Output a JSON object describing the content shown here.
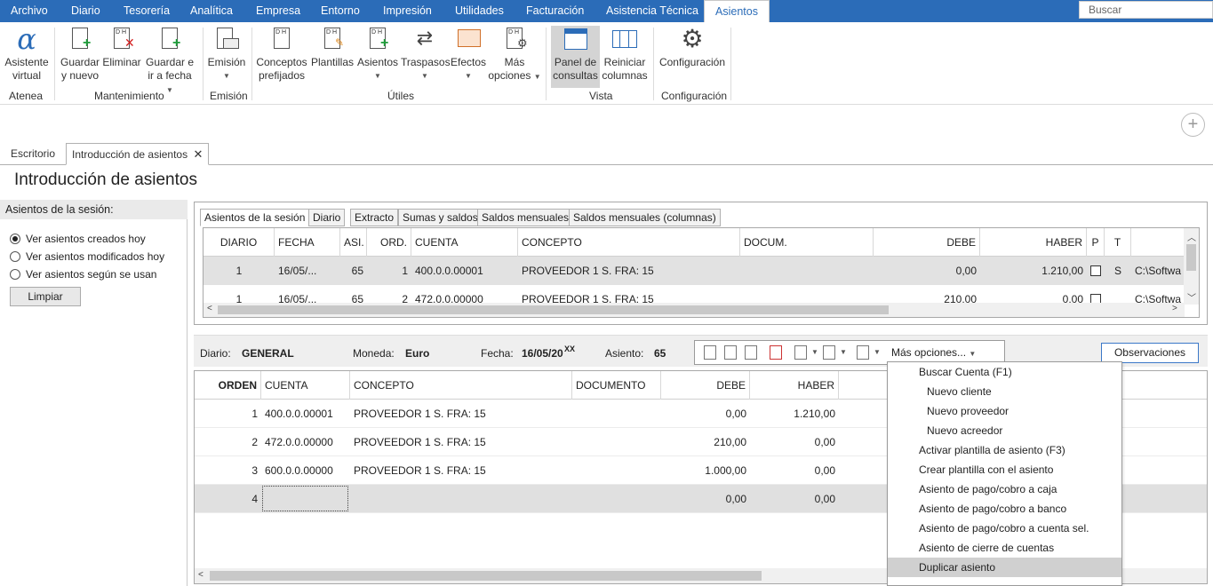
{
  "menubar": {
    "tabs": [
      "Archivo",
      "Diario",
      "Tesorería",
      "Analítica",
      "Empresa",
      "Entorno",
      "Impresión",
      "Utilidades",
      "Facturación",
      "Asistencia Técnica",
      "Asientos"
    ],
    "active_tab": "Asientos",
    "search_placeholder": "Buscar"
  },
  "ribbon": {
    "groups": {
      "atenea": "Atenea",
      "mantenimiento": "Mantenimiento",
      "emision": "Emisión",
      "utiles": "Útiles",
      "vista": "Vista",
      "configuracion": "Configuración"
    },
    "buttons": {
      "asistente": [
        "Asistente",
        "virtual"
      ],
      "guardar_nuevo": [
        "Guardar",
        "y nuevo"
      ],
      "eliminar": [
        "Eliminar"
      ],
      "guardar_fecha": [
        "Guardar e",
        "ir a fecha"
      ],
      "emision": [
        "Emisión"
      ],
      "conceptos": [
        "Conceptos",
        "prefijados"
      ],
      "plantillas": [
        "Plantillas"
      ],
      "asientos": [
        "Asientos"
      ],
      "traspasos": [
        "Traspasos"
      ],
      "efectos": [
        "Efectos"
      ],
      "mas_opciones": [
        "Más",
        "opciones"
      ],
      "panel": [
        "Panel de",
        "consultas"
      ],
      "reiniciar": [
        "Reiniciar",
        "columnas"
      ],
      "configuracion": [
        "Configuración"
      ]
    }
  },
  "doctabs": {
    "escritorio": "Escritorio",
    "introduccion": "Introducción de asientos"
  },
  "page_title": "Introducción de asientos",
  "session": {
    "heading": "Asientos de la sesión:",
    "options": [
      "Ver asientos creados hoy",
      "Ver asientos modificados hoy",
      "Ver asientos según se usan"
    ],
    "selected": 0,
    "clear_button": "Limpiar"
  },
  "top_tabs": [
    "Asientos de la sesión",
    "Diario",
    "Extracto",
    "Sumas y saldos",
    "Saldos mensuales",
    "Saldos mensuales (columnas)"
  ],
  "top_grid": {
    "headers": [
      "DIARIO",
      "FECHA",
      "ASI.",
      "ORD.",
      "CUENTA",
      "CONCEPTO",
      "DOCUM.",
      "DEBE",
      "HABER",
      "P",
      "T"
    ],
    "rows": [
      {
        "diario": "1",
        "fecha": "16/05/...",
        "asi": "65",
        "ord": "1",
        "cuenta": "400.0.0.00001",
        "concepto": "PROVEEDOR 1 S. FRA:  15",
        "docum": "",
        "debe": "0,00",
        "haber": "1.210,00",
        "t": "S",
        "path": "C:\\Softwa"
      },
      {
        "diario": "1",
        "fecha": "16/05/...",
        "asi": "65",
        "ord": "2",
        "cuenta": "472.0.0.00000",
        "concepto": "PROVEEDOR 1 S. FRA:  15",
        "docum": "",
        "debe": "210,00",
        "haber": "0,00",
        "t": "",
        "path": "C:\\Softwa"
      }
    ]
  },
  "infobar": {
    "diario_label": "Diario:",
    "diario_value": "GENERAL",
    "moneda_label": "Moneda:",
    "moneda_value": "Euro",
    "fecha_label": "Fecha:",
    "fecha_value": "16/05/20",
    "fecha_suffix": "XX",
    "asiento_label": "Asiento:",
    "asiento_value": "65",
    "mas_opciones": "Más opciones...",
    "observaciones": "Observaciones"
  },
  "bottom_grid": {
    "headers": [
      "ORDEN",
      "CUENTA",
      "CONCEPTO",
      "DOCUMENTO",
      "DEBE",
      "HABER"
    ],
    "rows": [
      {
        "orden": "1",
        "cuenta": "400.0.0.00001",
        "concepto": "PROVEEDOR 1 S. FRA:  15",
        "documento": "",
        "debe": "0,00",
        "haber": "1.210,00"
      },
      {
        "orden": "2",
        "cuenta": "472.0.0.00000",
        "concepto": "PROVEEDOR 1 S. FRA:  15",
        "documento": "",
        "debe": "210,00",
        "haber": "0,00"
      },
      {
        "orden": "3",
        "cuenta": "600.0.0.00000",
        "concepto": "PROVEEDOR 1 S. FRA:  15",
        "documento": "",
        "debe": "1.000,00",
        "haber": "0,00"
      },
      {
        "orden": "4",
        "cuenta": "",
        "concepto": "",
        "documento": "",
        "debe": "0,00",
        "haber": "0,00"
      }
    ]
  },
  "dropdown": {
    "items": [
      {
        "label": "Buscar Cuenta (F1)",
        "sub": false
      },
      {
        "label": "Nuevo cliente",
        "sub": true
      },
      {
        "label": "Nuevo proveedor",
        "sub": true
      },
      {
        "label": "Nuevo acreedor",
        "sub": true
      },
      {
        "label": "Activar plantilla de asiento (F3)",
        "sub": false
      },
      {
        "label": "Crear plantilla con el asiento",
        "sub": false
      },
      {
        "label": "Asiento de pago/cobro a caja",
        "sub": false
      },
      {
        "label": "Asiento de pago/cobro a banco",
        "sub": false
      },
      {
        "label": "Asiento de pago/cobro a cuenta sel.",
        "sub": false
      },
      {
        "label": "Asiento de cierre de cuentas",
        "sub": false
      },
      {
        "label": "Duplicar asiento",
        "sub": false
      }
    ],
    "highlighted": 10
  }
}
